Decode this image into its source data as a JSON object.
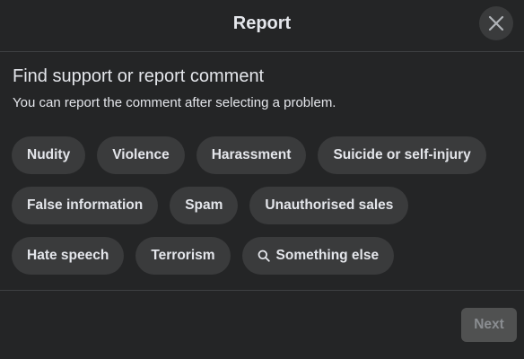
{
  "header": {
    "title": "Report",
    "close_icon": "close-icon"
  },
  "body": {
    "heading": "Find support or report comment",
    "subheading": "You can report the comment after selecting a problem."
  },
  "options": {
    "row1": [
      "Nudity",
      "Violence",
      "Harassment",
      "Suicide or self-injury"
    ],
    "row2": [
      "False information",
      "Spam",
      "Unauthorised sales"
    ],
    "row3": [
      "Hate speech",
      "Terrorism",
      "Something else"
    ],
    "something_else_icon": "search-icon"
  },
  "footer": {
    "next_label": "Next",
    "next_enabled": false
  },
  "colors": {
    "background": "#242526",
    "chip": "#3a3b3c",
    "text": "#e4e6eb",
    "disabled_button": "#505151",
    "disabled_text": "#8a8d91"
  }
}
